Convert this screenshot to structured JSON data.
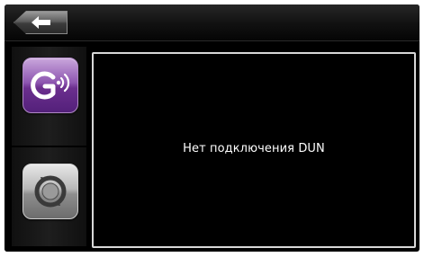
{
  "toolbar": {
    "back_icon": "arrow-left-icon"
  },
  "sidebar": {
    "items": [
      {
        "icon": "gprs-signal-icon",
        "color": "#8d55b0"
      },
      {
        "icon": "sync-icon",
        "color": "#b8b8b8"
      }
    ]
  },
  "main": {
    "status_message": "Нет подключения DUN"
  },
  "colors": {
    "background": "#000000",
    "panel_border": "#d8d8d8",
    "text": "#ffffff"
  }
}
